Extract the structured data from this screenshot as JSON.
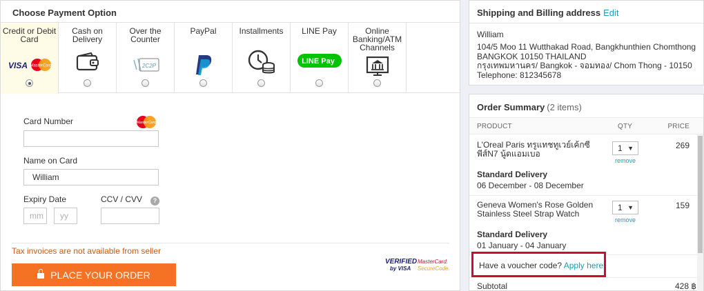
{
  "payment": {
    "title": "Choose Payment Option",
    "methods": [
      {
        "label": "Credit or Debit Card",
        "icon": "visa-mastercard-icon",
        "selected": true
      },
      {
        "label": "Cash on Delivery",
        "icon": "wallet-icon",
        "selected": false
      },
      {
        "label": "Over the Counter",
        "icon": "counter-payment-icon",
        "selected": false
      },
      {
        "label": "PayPal",
        "icon": "paypal-icon",
        "selected": false
      },
      {
        "label": "Installments",
        "icon": "clock-coins-icon",
        "selected": false
      },
      {
        "label": "LINE Pay",
        "icon": "line-pay-icon",
        "selected": false
      },
      {
        "label": "Online Banking/ATM Channels",
        "icon": "bank-icon",
        "selected": false
      }
    ],
    "brand_text": {
      "visa": "VISA",
      "mastercard": "MasterCard",
      "line_pay": "LINE Pay",
      "counter": "2C2P"
    },
    "card_form": {
      "card_number_label": "Card Number",
      "card_number_value": "",
      "name_label": "Name on Card",
      "name_value": "William",
      "expiry_label": "Expiry Date",
      "month_placeholder": "mm",
      "year_placeholder": "yy",
      "cvv_label": "CCV / CVV",
      "cvv_value": "",
      "help_glyph": "?"
    },
    "tax_note": "Tax invoices are not available from seller",
    "place_order_label": "PLACE YOUR ORDER",
    "secure_badge": {
      "verified_line1": "VERIFIED",
      "verified_line2": "by VISA",
      "mc_line1": "MasterCard.",
      "mc_line2": "SecureCode."
    }
  },
  "shipping": {
    "title": "Shipping and Billing address",
    "edit_label": "Edit",
    "name": "William",
    "address_lines": [
      "104/5 Moo 11 Wutthakad Road, Bangkhunthien Chomthong",
      "BANGKOK 10150 THAILAND",
      "กรุงเทพมหานคร/ Bangkok - จอมทอง/ Chom Thong - 10150",
      "Telephone: 812345678"
    ]
  },
  "order": {
    "title": "Order Summary",
    "count": "(2 items)",
    "columns": {
      "product": "PRODUCT",
      "qty": "QTY",
      "price": "PRICE"
    },
    "items": [
      {
        "name": "L'Oreal Paris ทรูแทชทูเวย์เค้กซีพีส์N7 นู้ดแอมเบอ",
        "qty": "1",
        "price": "269",
        "remove": "remove",
        "delivery_title": "Standard Delivery",
        "delivery_date": "06 December - 08 December"
      },
      {
        "name": "Geneva Women's Rose Golden Stainless Steel Strap Watch",
        "qty": "1",
        "price": "159",
        "remove": "remove",
        "delivery_title": "Standard Delivery",
        "delivery_date": "01 January - 04 January"
      }
    ],
    "voucher_prompt": "Have a voucher code?",
    "voucher_link": "Apply here",
    "subtotal_label": "Subtotal",
    "subtotal_value": "428 ฿",
    "colors": {
      "accent": "#f57224",
      "link": "#1a9cb7",
      "highlight_border": "#c8102e"
    }
  }
}
